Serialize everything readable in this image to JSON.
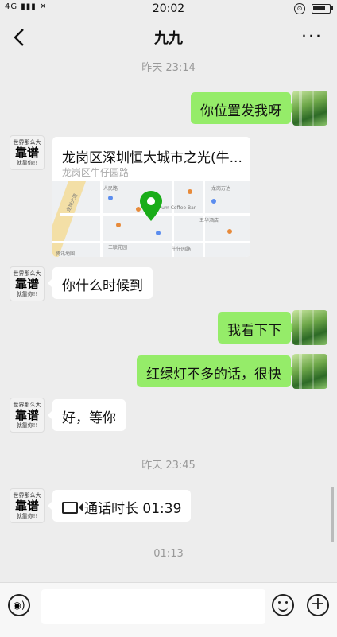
{
  "status": {
    "network": "4G",
    "time": "20:02",
    "battery_level": 0.85
  },
  "header": {
    "title": "九九",
    "more": "···"
  },
  "messages": {
    "ts1": "昨天 23:14",
    "m1": "你位置发我呀",
    "location": {
      "title": "龙岗区深圳恒大城市之光(牛...",
      "subtitle": "龙岗区牛仔园路"
    },
    "m2": "你什么时候到",
    "m3": "我看下下",
    "m4": "红绿灯不多的话，很快",
    "m5": "好，等你",
    "ts2": "昨天 23:45",
    "call": "通话时长 01:39",
    "ts3": "01:13"
  },
  "avatar_other": {
    "line1": "世界那么大",
    "line2": "靠谱",
    "line3": "就靠你!!"
  },
  "map": {
    "labels": [
      "人民路",
      "龙岗大道",
      "Mum Coffee Bar",
      "五华酒店",
      "腾讯地图",
      "三联花园",
      "牛仔园路",
      "龙岗万达"
    ]
  },
  "colors": {
    "me_bubble": "#95ec69",
    "other_bubble": "#ffffff",
    "bg": "#ededed",
    "pin": "#1aad19"
  },
  "icons": [
    "back-icon",
    "more-icon",
    "video-call-icon",
    "voice-icon",
    "emoji-icon",
    "plus-icon",
    "location-pin-icon",
    "battery-icon",
    "lock-icon"
  ]
}
